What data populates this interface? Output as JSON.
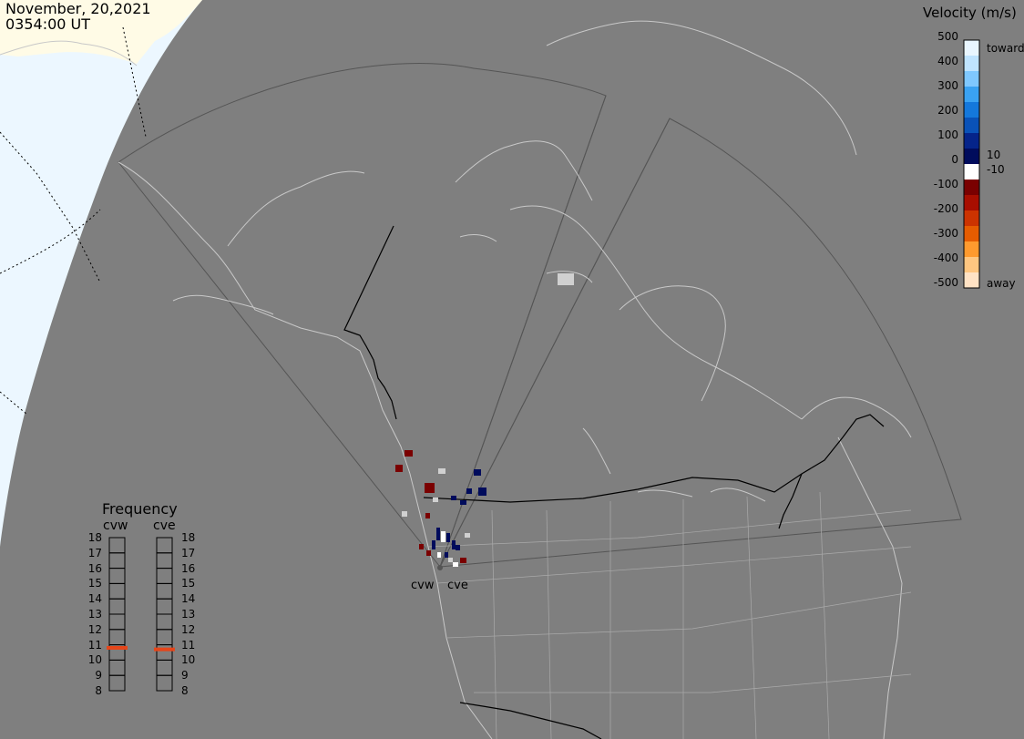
{
  "header": {
    "date": "November, 20,2021",
    "time": "0354:00 UT"
  },
  "velocity_scale": {
    "title": "Velocity (m/s)",
    "ticks": [
      "500",
      "400",
      "300",
      "200",
      "100",
      "10",
      "0",
      "-10",
      "-100",
      "-200",
      "-300",
      "-400",
      "-500"
    ],
    "end_labels": {
      "top": "toward",
      "bottom": "away"
    },
    "colors": [
      "#e9f6ff",
      "#bfe4ff",
      "#7fc8ff",
      "#3aa2f2",
      "#1478dc",
      "#0a52b8",
      "#05248a",
      "#000c5c",
      "#ffffff",
      "#7a0000",
      "#a80e00",
      "#cc3300",
      "#e65c00",
      "#ff9a2e",
      "#ffc680",
      "#ffe2c4"
    ]
  },
  "frequency": {
    "title": "Frequency",
    "radars": [
      "cvw",
      "cve"
    ],
    "ticks": [
      "18",
      "17",
      "16",
      "15",
      "14",
      "13",
      "12",
      "11",
      "10",
      "9",
      "8"
    ],
    "values_mhz": [
      10.8,
      10.7
    ],
    "marker_color": "#e6461a"
  },
  "radars": [
    {
      "code": "cvw"
    },
    {
      "code": "cve"
    }
  ],
  "colors": {
    "background": "#7f7f7f",
    "daylight": "#ecf7ff",
    "ice": "#fffbe6",
    "coast": "#c8c8c8",
    "border": "#000000",
    "fov": "#555555"
  }
}
